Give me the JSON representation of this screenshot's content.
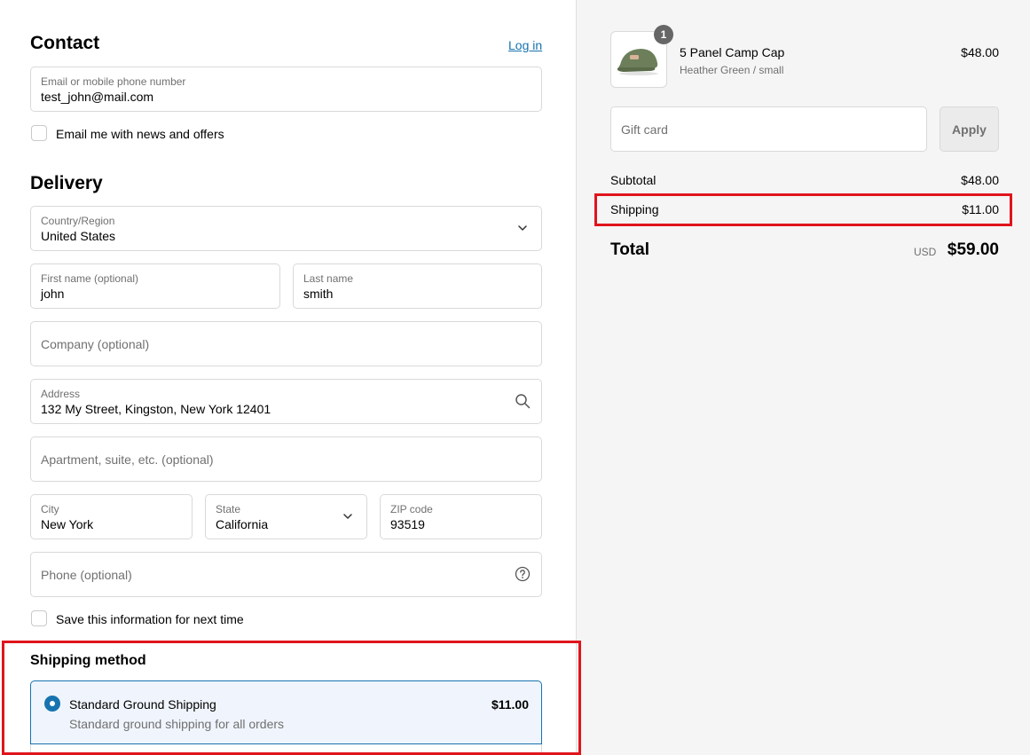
{
  "contact": {
    "heading": "Contact",
    "login_link": "Log in",
    "email": {
      "label": "Email or mobile phone number",
      "value": "test_john@mail.com"
    },
    "newsletter_label": "Email me with news and offers"
  },
  "delivery": {
    "heading": "Delivery",
    "country": {
      "label": "Country/Region",
      "value": "United States"
    },
    "first_name": {
      "label": "First name (optional)",
      "value": "john"
    },
    "last_name": {
      "label": "Last name",
      "value": "smith"
    },
    "company": {
      "placeholder": "Company (optional)"
    },
    "address": {
      "label": "Address",
      "value": "132 My Street, Kingston, New York 12401"
    },
    "apartment": {
      "placeholder": "Apartment, suite, etc. (optional)"
    },
    "city": {
      "label": "City",
      "value": "New York"
    },
    "state": {
      "label": "State",
      "value": "California"
    },
    "zip": {
      "label": "ZIP code",
      "value": "93519"
    },
    "phone": {
      "placeholder": "Phone (optional)"
    },
    "save_info_label": "Save this information for next time"
  },
  "shipping_method": {
    "heading": "Shipping method",
    "option": {
      "name": "Standard Ground Shipping",
      "description": "Standard ground shipping for all orders",
      "price": "$11.00"
    }
  },
  "summary": {
    "product": {
      "quantity": "1",
      "name": "5 Panel Camp Cap",
      "variant": "Heather Green / small",
      "price": "$48.00"
    },
    "gift_card": {
      "placeholder": "Gift card",
      "apply_label": "Apply"
    },
    "subtotal": {
      "label": "Subtotal",
      "value": "$48.00"
    },
    "shipping": {
      "label": "Shipping",
      "value": "$11.00"
    },
    "total": {
      "label": "Total",
      "currency": "USD",
      "value": "$59.00"
    }
  },
  "colors": {
    "accent": "#1773b0",
    "highlight_box": "#e0141c",
    "summary_bg": "#f5f5f5"
  }
}
